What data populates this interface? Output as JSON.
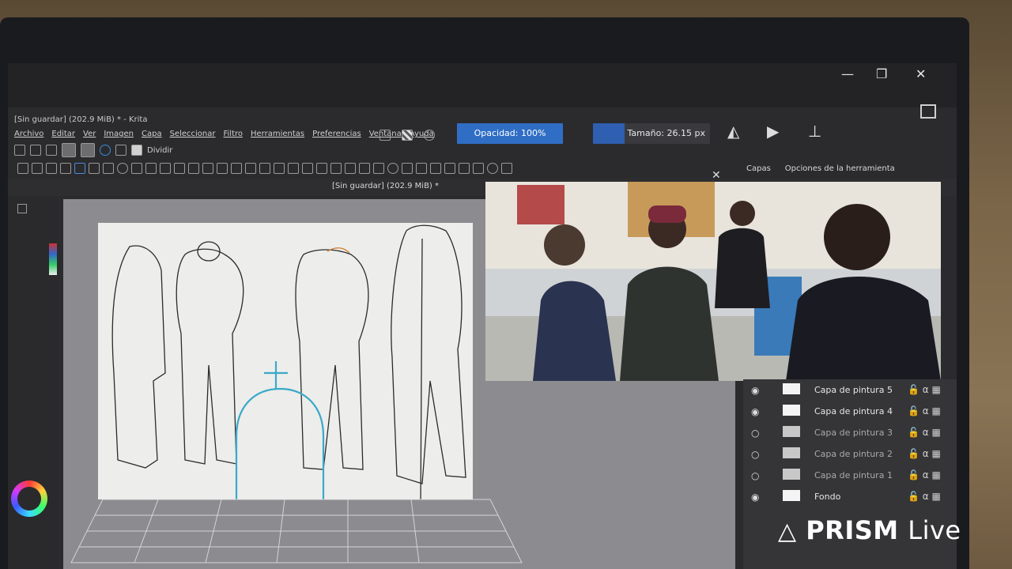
{
  "window": {
    "title": "[Sin guardar] (202.9 MiB) * - Krita",
    "controls": [
      "—",
      "❐",
      "✕"
    ]
  },
  "menubar": [
    "Archivo",
    "Editar",
    "Ver",
    "Imagen",
    "Capa",
    "Seleccionar",
    "Filtro",
    "Herramientas",
    "Preferencias",
    "Ventana",
    "Ayuda"
  ],
  "toolbar": {
    "blend_label": "Dividir",
    "opacity_label": "Opacidad: 100%",
    "size_label": "Tamaño: 26.15 px"
  },
  "document": {
    "tab_title": "[Sin guardar]  (202.9 MiB) *"
  },
  "dock_tabs": {
    "layers": "Capas",
    "tool_options": "Opciones de la herramienta"
  },
  "layers": [
    {
      "name": "Capa de pintura 5",
      "visible": true
    },
    {
      "name": "Capa de pintura 4",
      "visible": true
    },
    {
      "name": "Capa de pintura 3",
      "visible": false
    },
    {
      "name": "Capa de pintura 2",
      "visible": false
    },
    {
      "name": "Capa de pintura 1",
      "visible": false
    },
    {
      "name": "Fondo",
      "visible": true
    }
  ],
  "layer_icons": {
    "lock": "lock-icon",
    "alpha": "α",
    "pattern": "checker-icon"
  },
  "watermark": {
    "brand": "PRISM",
    "suffix": "Live"
  },
  "colors": {
    "accent": "#2f6ec4",
    "sketch_cyan": "#3aa9c8"
  }
}
